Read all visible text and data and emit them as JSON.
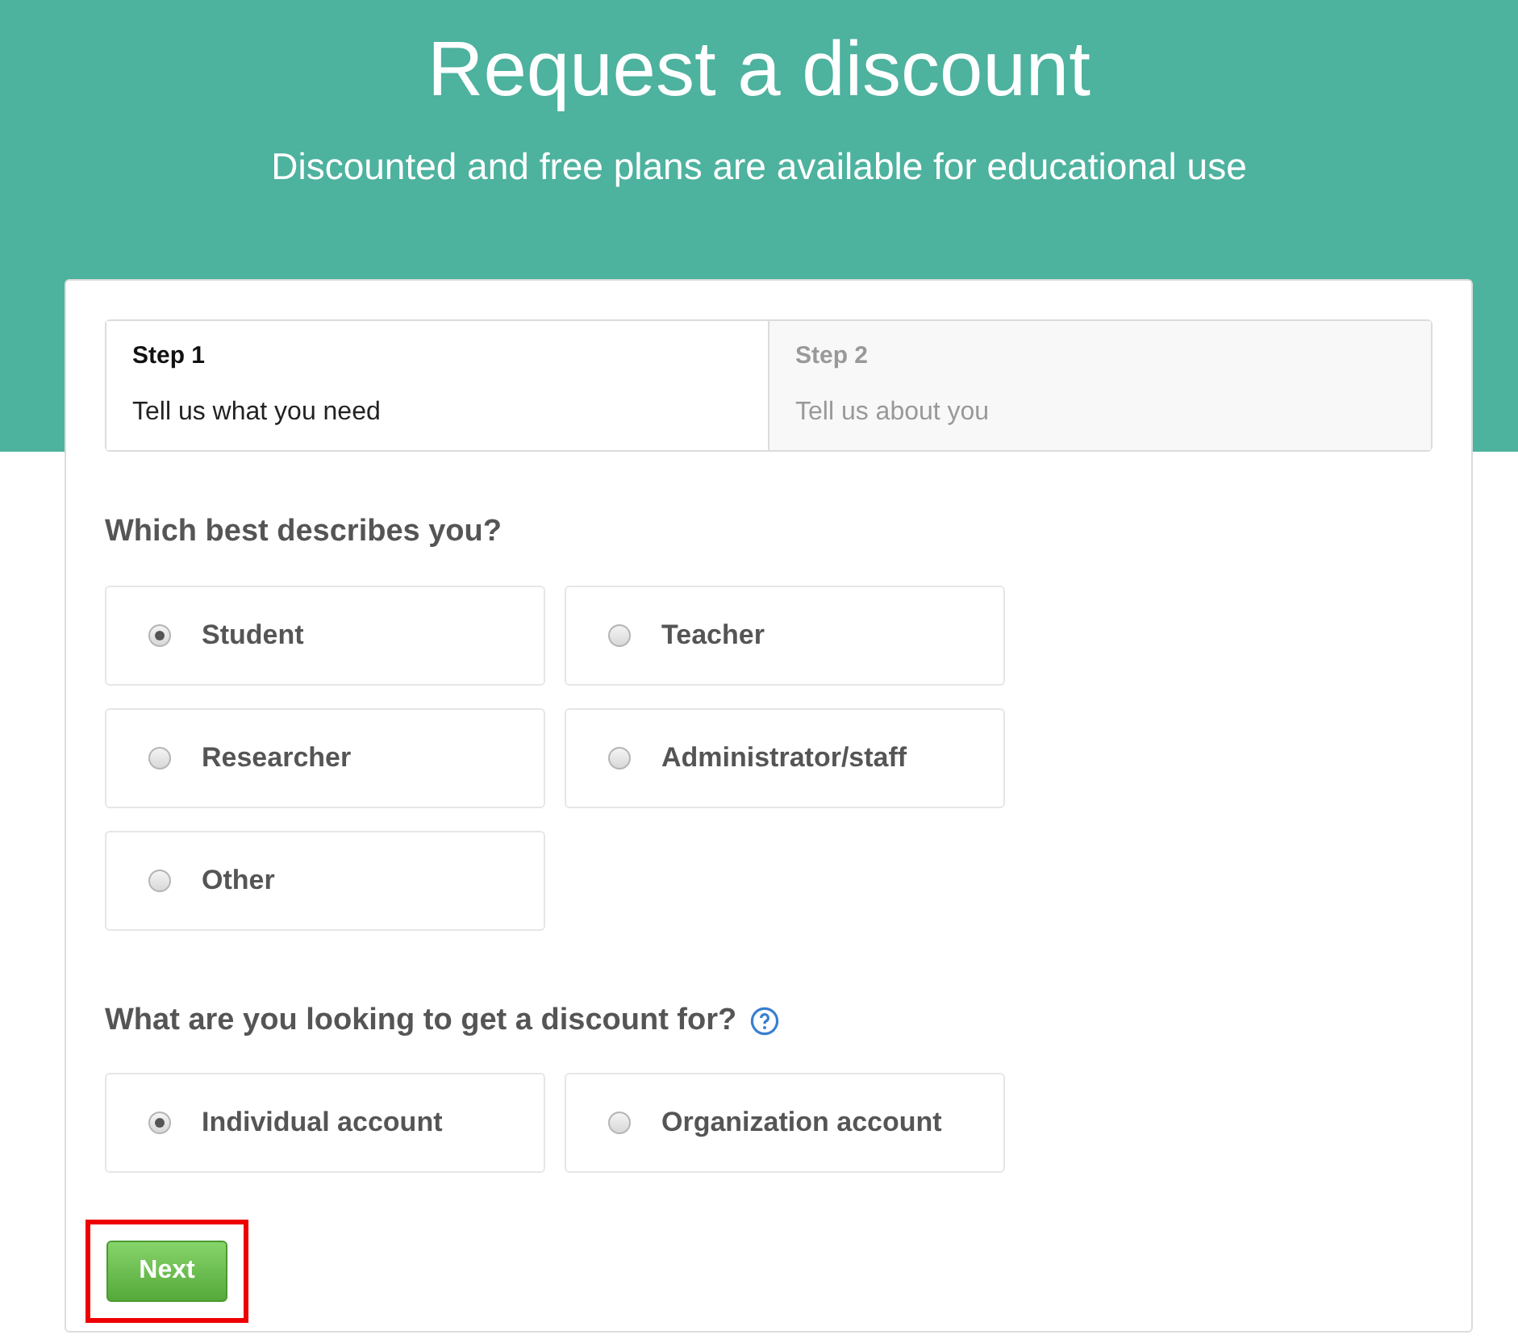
{
  "header": {
    "title": "Request a discount",
    "subtitle": "Discounted and free plans are available for educational use"
  },
  "steps": [
    {
      "label": "Step 1",
      "description": "Tell us what you need",
      "selected": true
    },
    {
      "label": "Step 2",
      "description": "Tell us about you",
      "selected": false
    }
  ],
  "role_question": {
    "label": "Which best describes you?",
    "options": [
      {
        "label": "Student",
        "selected": true
      },
      {
        "label": "Teacher",
        "selected": false
      },
      {
        "label": "Researcher",
        "selected": false
      },
      {
        "label": "Administrator/staff",
        "selected": false
      },
      {
        "label": "Other",
        "selected": false
      }
    ]
  },
  "discount_question": {
    "label": "What are you looking to get a discount for?",
    "has_help": true,
    "options": [
      {
        "label": "Individual account",
        "selected": true
      },
      {
        "label": "Organization account",
        "selected": false
      }
    ]
  },
  "next_button": {
    "label": "Next",
    "highlighted": true
  }
}
